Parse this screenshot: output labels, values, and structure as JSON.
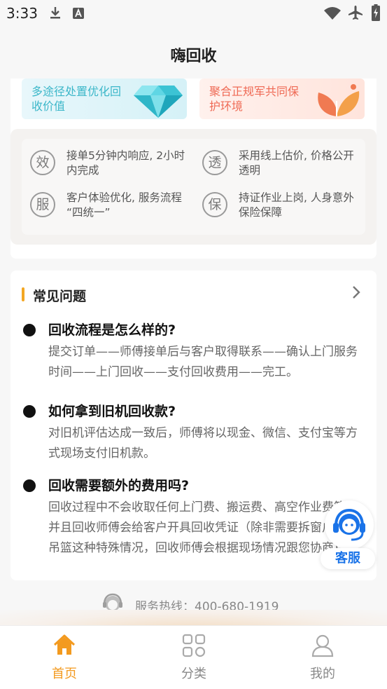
{
  "status_bar": {
    "time": "3:33",
    "icons": [
      "download-icon",
      "text-a-icon",
      "wifi-icon",
      "airplane-mode-icon",
      "battery-charging-icon"
    ]
  },
  "header": {
    "title": "嗨回收"
  },
  "promos": [
    {
      "text": "多途径处置优化回收价值",
      "icon": "diamond-icon",
      "color": "#3cb7c9"
    },
    {
      "text": "聚合正规军共同保护环境",
      "icon": "leaf-icon",
      "color": "#ef6a55"
    }
  ],
  "features": [
    {
      "badge": "效",
      "text": "接单5分钟内响应, 2小时内完成"
    },
    {
      "badge": "透",
      "text": "采用线上估价, 价格公开透明"
    },
    {
      "badge": "服",
      "text": "客户体验优化, 服务流程 “四统一”"
    },
    {
      "badge": "保",
      "text": "持证作业上岗, 人身意外保险保障"
    }
  ],
  "faq": {
    "title": "常见问题",
    "accent": "#f3a723",
    "items": [
      {
        "q": "回收流程是怎么样的?",
        "a": "提交订单——师傅接单后与客户取得联系——确认上门服务时间——上门回收——支付回收费用——完工。"
      },
      {
        "q": "如何拿到旧机回收款?",
        "a": "对旧机评估达成一致后，师傅将以现金、微信、支付宝等方式现场支付旧机款。"
      },
      {
        "q": "回收需要额外的费用吗?",
        "a": "回收过程中不会收取任何上门费、搬运费、高空作业费等，并且回收师傅会给客户开具回收凭证（除非需要拆窗户或者吊篮这种特殊情况，回收师傅会根据现场情况跟您协商)"
      }
    ]
  },
  "service_button": {
    "label": "客服",
    "color": "#1a73e8"
  },
  "hotline": {
    "text": "服务热线：400-680-1919"
  },
  "bottom_nav": {
    "active_color": "#f39a1f",
    "items": [
      {
        "label": "首页",
        "icon": "home-icon"
      },
      {
        "label": "分类",
        "icon": "grid-icon"
      },
      {
        "label": "我的",
        "icon": "user-icon"
      }
    ]
  }
}
